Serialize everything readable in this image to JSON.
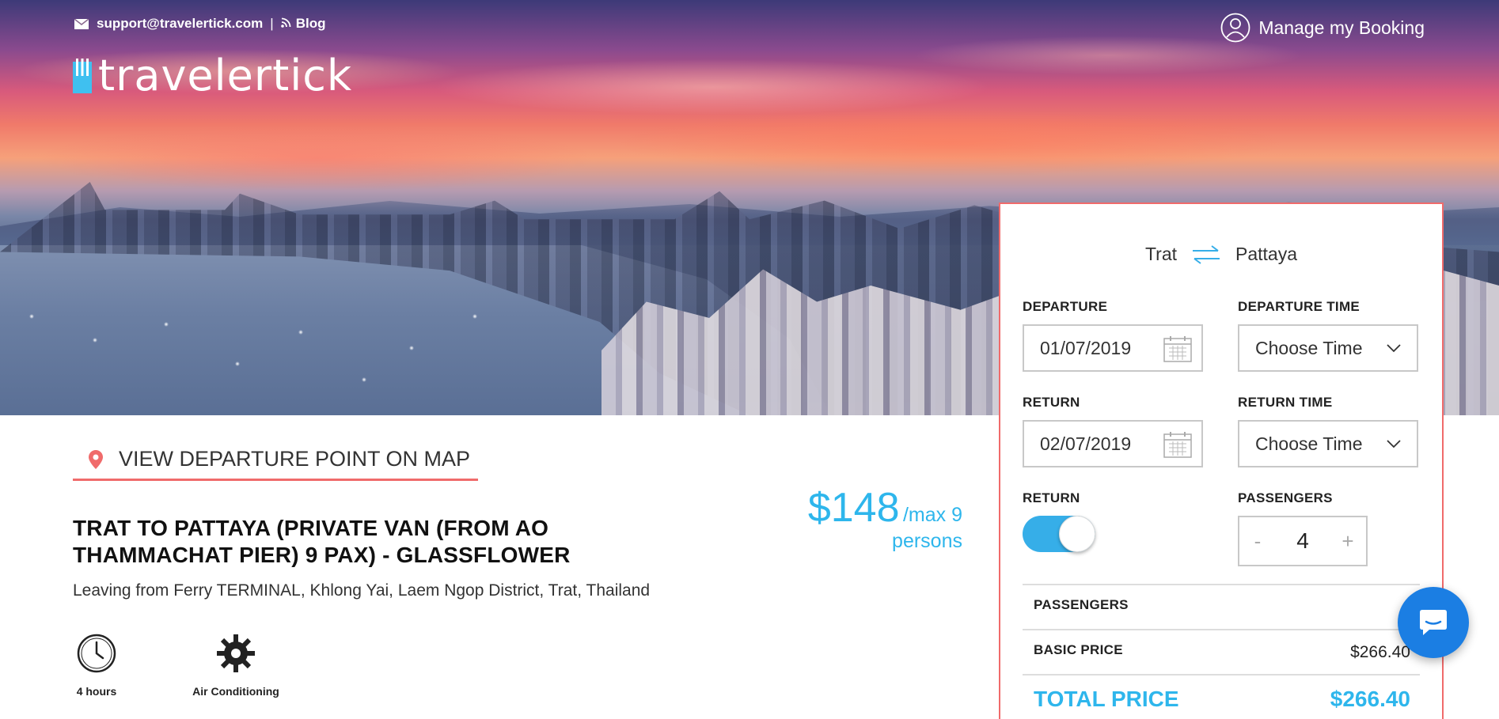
{
  "header": {
    "email": "support@travelertick.com",
    "separator": "|",
    "blog_label": "Blog",
    "logo_text": "travelertick",
    "manage_booking": "Manage my Booking"
  },
  "booking": {
    "from": "Trat",
    "to": "Pattaya",
    "departure_label": "DEPARTURE",
    "departure_date": "01/07/2019",
    "departure_time_label": "DEPARTURE TIME",
    "departure_time_value": "Choose Time",
    "return_label": "RETURN",
    "return_date": "02/07/2019",
    "return_time_label": "RETURN TIME",
    "return_time_value": "Choose Time",
    "return_toggle_label": "RETURN",
    "return_toggle_on": true,
    "passengers_label": "PASSENGERS",
    "passengers_minus": "-",
    "passengers_count": "4",
    "passengers_plus": "+",
    "summary_passengers_label": "PASSENGERS",
    "basic_price_label": "BASIC PRICE",
    "basic_price_value": "$266.40",
    "total_price_label": "TOTAL PRICE",
    "total_price_value": "$266.40"
  },
  "trip": {
    "map_link": "VIEW DEPARTURE POINT ON MAP",
    "title": "TRAT TO PATTAYA (PRIVATE VAN (FROM AO THAMMACHAT PIER) 9 PAX) - GLASSFLOWER",
    "subtitle": "Leaving from Ferry TERMINAL, Khlong Yai, Laem Ngop District, Trat, Thailand",
    "price_amount": "$148",
    "price_per": "/max 9",
    "price_persons": "persons",
    "features": [
      {
        "label": "4 hours",
        "icon": "clock-icon"
      },
      {
        "label": "Air Conditioning",
        "icon": "snowflake-gear-icon"
      }
    ]
  },
  "colors": {
    "accent_blue": "#2eb6ec",
    "accent_red": "#f06b6b",
    "chat_blue": "#1b7ee3"
  }
}
